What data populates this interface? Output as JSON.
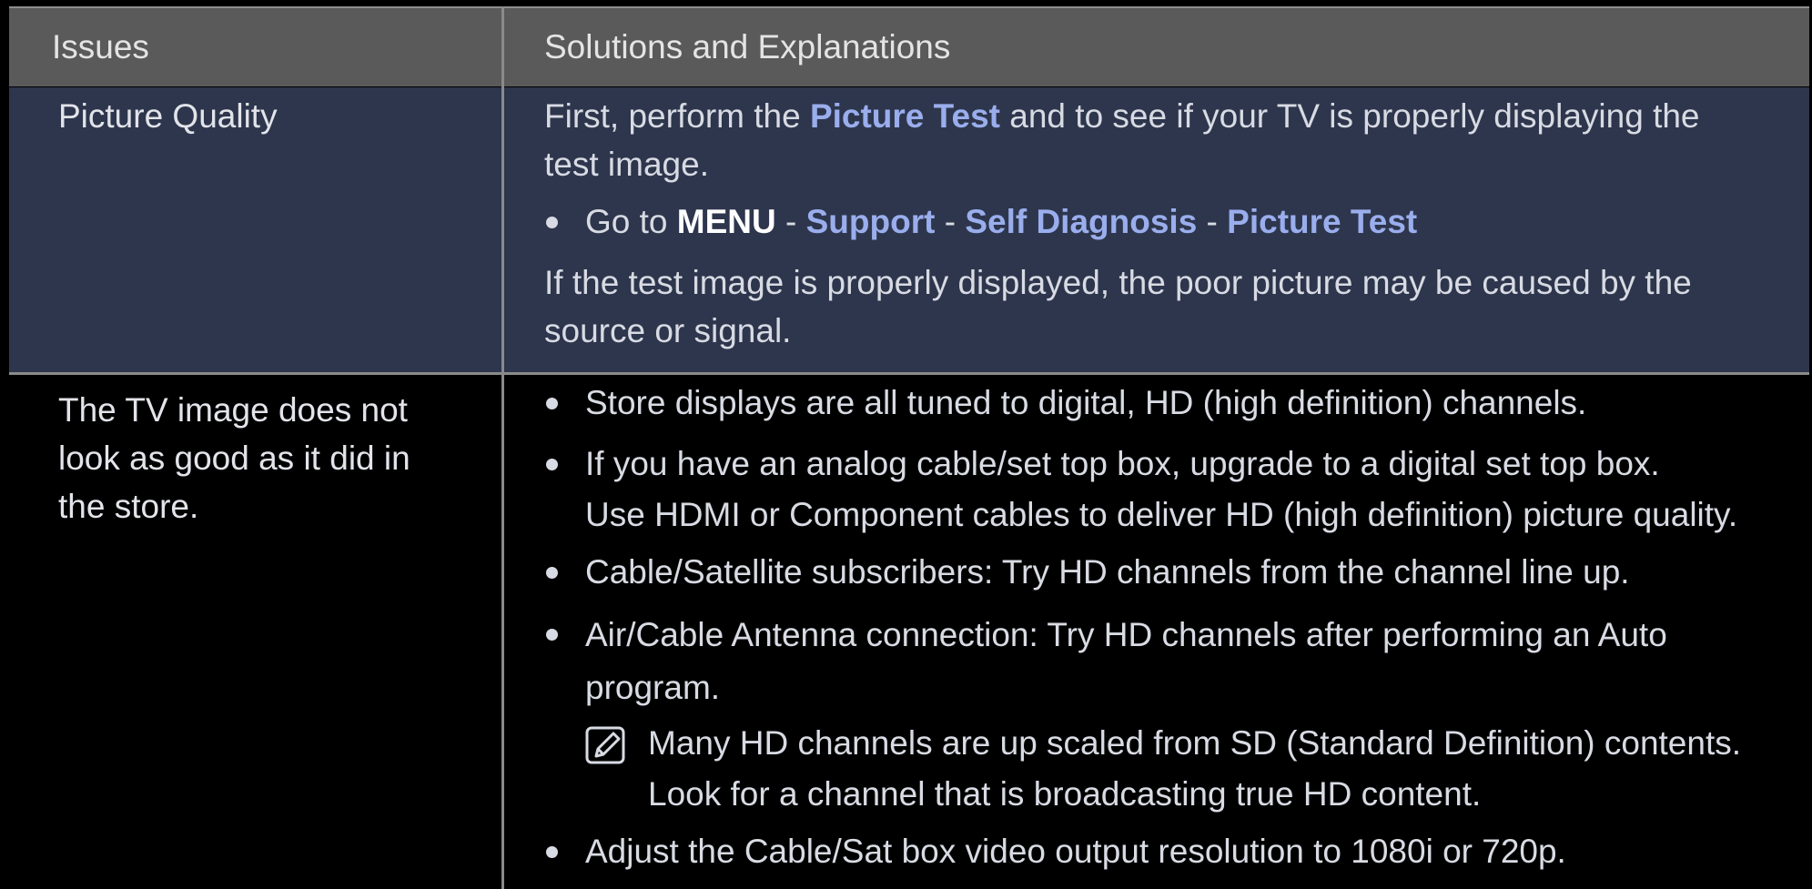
{
  "header": {
    "col1": "Issues",
    "col2": "Solutions and Explanations"
  },
  "row1": {
    "issue": "Picture Quality",
    "intro_pre": "First, perform the ",
    "intro_link": "Picture Test",
    "intro_post_1": " and to see if your TV is properly displaying the",
    "intro_post_2": "test image.",
    "path_prefix": "Go to ",
    "path_menu": "MENU",
    "path_sep": " - ",
    "path_support": "Support",
    "path_self_diagnosis": "Self Diagnosis",
    "path_picture_test": "Picture Test",
    "outro_1": "If the test image is properly displayed, the poor picture may be caused by the",
    "outro_2": "source or signal."
  },
  "row2": {
    "issue_lines": [
      "The TV image does not",
      "look as good as it did in",
      "the store."
    ],
    "bullet1": "Store displays are all tuned to digital, HD (high definition) channels.",
    "bullet2_line1": "If you have an analog cable/set top box, upgrade to a digital set top box.",
    "bullet2_line2": "Use HDMI or Component cables to deliver HD (high definition) picture quality.",
    "bullet3": "Cable/Satellite subscribers: Try HD channels from the channel line up.",
    "bullet4_line1": "Air/Cable Antenna connection: Try HD channels after performing an Auto",
    "bullet4_line2": "program.",
    "note_line1": "Many HD channels are up scaled from SD (Standard Definition) contents.",
    "note_line2": "Look for a channel that is broadcasting true HD content.",
    "bullet5": "Adjust the Cable/Sat box video output resolution to 1080i or 720p."
  },
  "icons": {
    "bullet": "bullet-dot-icon",
    "note": "note-pencil-icon"
  },
  "colors": {
    "header_bg": "#5a5a5a",
    "row1_bg": "#2e364d",
    "row2_bg": "#000000",
    "highlight": "#9aaeed"
  }
}
